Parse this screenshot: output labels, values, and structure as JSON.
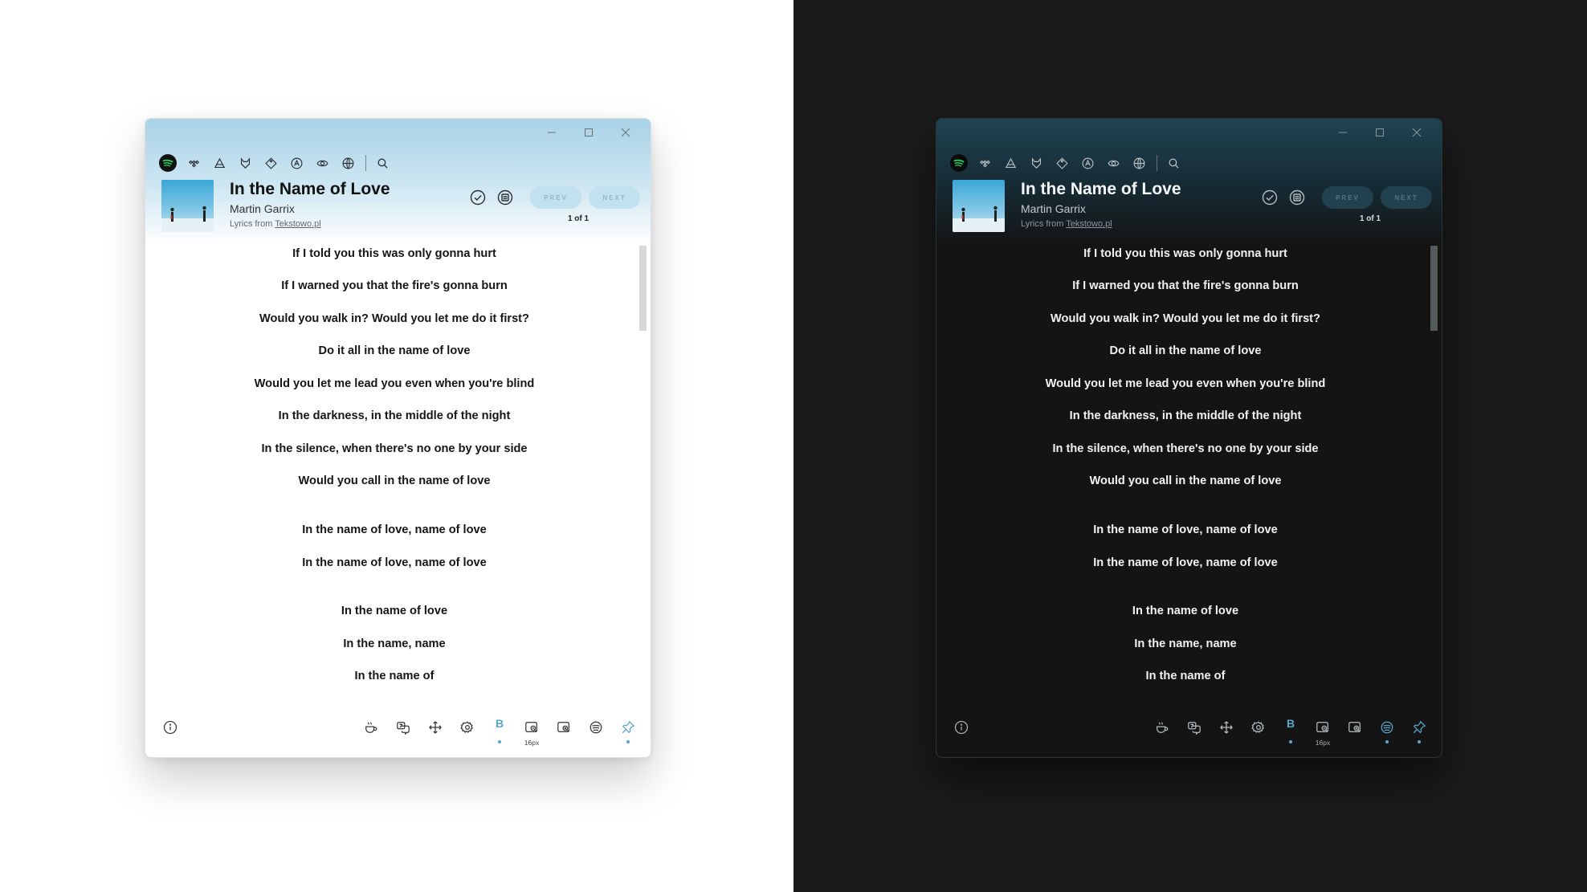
{
  "track": {
    "title": "In the Name of Love",
    "artist": "Martin Garrix",
    "source_prefix": "Lyrics from",
    "source_name": "Tekstowo.pl"
  },
  "nav": {
    "prev_label": "PREV",
    "next_label": "NEXT",
    "page_count": "1 of 1"
  },
  "lyrics": [
    "If I told you this was only gonna hurt",
    "If I warned you that the fire's gonna burn",
    "Would you walk in? Would you let me do it first?",
    "Do it all in the name of love",
    "Would you let me lead you even when you're blind",
    "In the darkness, in the middle of the night",
    "In the silence, when there's no one by your side",
    "Would you call in the name of love",
    "In the name of love, name of love",
    "In the name of love, name of love",
    "In the name of love",
    "In the name, name",
    "In the name of"
  ],
  "footer": {
    "bold_toggle_label": "B",
    "font_size": "16px"
  },
  "sources": [
    "spotify-icon",
    "tidal-icon",
    "triangle-source-icon",
    "fox-source-icon",
    "tag-source-icon",
    "circle-a-source-icon",
    "leaf-source-icon",
    "globe-source-icon"
  ],
  "colors": {
    "accent": "#5aa6c8",
    "spotify_green": "#1ed760",
    "light_header": "#a9d2e6",
    "dark_header": "#1f4352",
    "dark_background": "#1b1b1b"
  }
}
